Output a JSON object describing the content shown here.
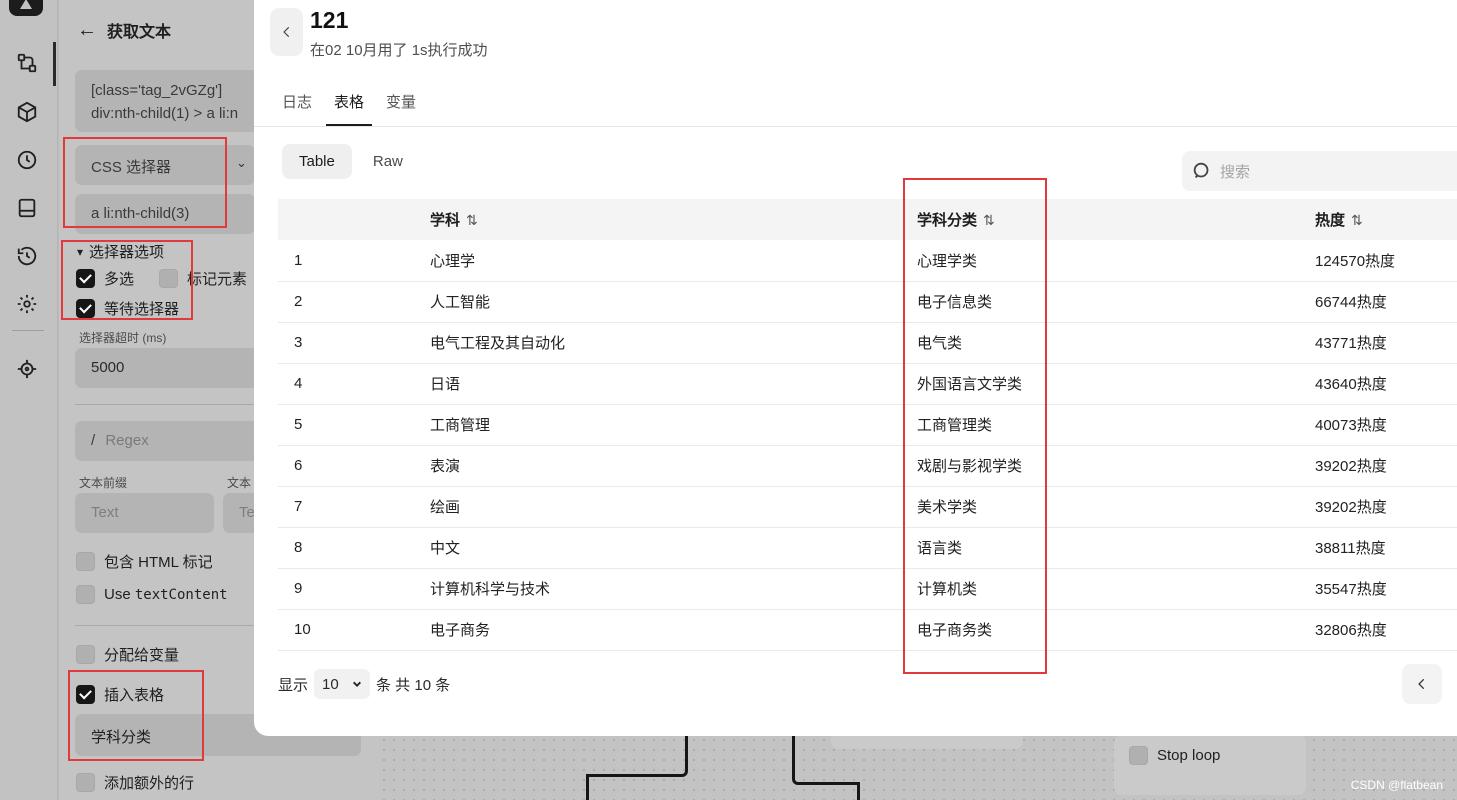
{
  "sidebar_icons": [
    "workflow-icon",
    "cube-icon",
    "clock-icon",
    "layout-icon",
    "history-icon",
    "gear-icon",
    "target-icon"
  ],
  "panel": {
    "title": "获取文本",
    "selector_text_line1": "[class='tag_2vGZg']",
    "selector_text_line2": "div:nth-child(1) > a li:n",
    "selector_type": "CSS 选择器",
    "selector_value": "a li:nth-child(3)",
    "selector_options_label": "选择器选项",
    "multi_select": "多选",
    "mark_elements": "标记元素",
    "wait_selector": "等待选择器",
    "timeout_label": "选择器超时 (ms)",
    "timeout_value": "5000",
    "regex_slash": "/",
    "regex_placeholder": "Regex",
    "prefix_label": "文本前缀",
    "suffix_label": "文本",
    "prefix_placeholder": "Text",
    "suffix_placeholder": "Te",
    "include_html": "包含 HTML 标记",
    "use_textcontent_prefix": "Use ",
    "use_textcontent_code": "textContent",
    "assign_variable": "分配给变量",
    "insert_table": "插入表格",
    "table_column": "学科分类",
    "add_extra_row": "添加额外的行"
  },
  "canvas": {
    "stop_loop": "Stop loop"
  },
  "modal": {
    "title": "121",
    "subtitle": "在02 10月用了 1s执行成功",
    "tabs": [
      "日志",
      "表格",
      "变量"
    ],
    "active_tab": "表格",
    "view_modes": [
      "Table",
      "Raw"
    ],
    "search_placeholder": "搜索",
    "columns": [
      "",
      "学科",
      "学科分类",
      "热度"
    ],
    "sort_glyph": "⇅",
    "rows": [
      [
        "1",
        "心理学",
        "心理学类",
        "124570热度"
      ],
      [
        "2",
        "人工智能",
        "电子信息类",
        "66744热度"
      ],
      [
        "3",
        "电气工程及其自动化",
        "电气类",
        "43771热度"
      ],
      [
        "4",
        "日语",
        "外国语言文学类",
        "43640热度"
      ],
      [
        "5",
        "工商管理",
        "工商管理类",
        "40073热度"
      ],
      [
        "6",
        "表演",
        "戏剧与影视学类",
        "39202热度"
      ],
      [
        "7",
        "绘画",
        "美术学类",
        "39202热度"
      ],
      [
        "8",
        "中文",
        "语言类",
        "38811热度"
      ],
      [
        "9",
        "计算机科学与技术",
        "计算机类",
        "35547热度"
      ],
      [
        "10",
        "电子商务",
        "电子商务类",
        "32806热度"
      ]
    ],
    "footer_show": "显示",
    "page_size": "10",
    "footer_total": "条 共 10 条"
  },
  "watermark": "CSDN @flatbean",
  "colors": {
    "highlight": "#e03a3a",
    "overlay": "#c4c4c4",
    "active_check": "#161616"
  }
}
